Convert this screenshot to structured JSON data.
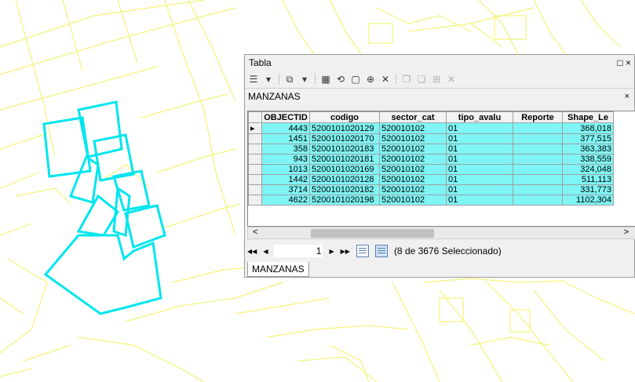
{
  "window": {
    "title": "Tabla",
    "maximize_glyph": "□",
    "close_glyph": "×"
  },
  "toolbar": {
    "icons": [
      "table-options-icon",
      "related-tables-icon",
      "select-by-attributes-icon",
      "switch-selection-icon",
      "clear-selection-icon",
      "zoom-to-selected-icon",
      "delete-selected-icon",
      "copy-icon",
      "paste-icon",
      "add-icon",
      "remove-icon"
    ],
    "dropdown_glyph": "▾"
  },
  "table_tab": {
    "name": "MANZANAS",
    "close_glyph": "×"
  },
  "grid": {
    "columns": [
      "OBJECTID",
      "codigo",
      "sector_cat",
      "tipo_avalu",
      "Reporte",
      "Shape_Le"
    ],
    "rows": [
      {
        "objectid": "4443",
        "codigo": "5200101020129",
        "sector_cat": "520010102",
        "tipo_avalu": "01",
        "reporte": "",
        "shape_le": "368,018"
      },
      {
        "objectid": "1451",
        "codigo": "5200101020170",
        "sector_cat": "520010102",
        "tipo_avalu": "01",
        "reporte": "",
        "shape_le": "377,515"
      },
      {
        "objectid": "358",
        "codigo": "5200101020183",
        "sector_cat": "520010102",
        "tipo_avalu": "01",
        "reporte": "",
        "shape_le": "363,383"
      },
      {
        "objectid": "943",
        "codigo": "5200101020181",
        "sector_cat": "520010102",
        "tipo_avalu": "01",
        "reporte": "",
        "shape_le": "338,559"
      },
      {
        "objectid": "1013",
        "codigo": "5200101020169",
        "sector_cat": "520010102",
        "tipo_avalu": "01",
        "reporte": "",
        "shape_le": "324,048"
      },
      {
        "objectid": "1442",
        "codigo": "5200101020128",
        "sector_cat": "520010102",
        "tipo_avalu": "01",
        "reporte": "",
        "shape_le": "511,113"
      },
      {
        "objectid": "3714",
        "codigo": "5200101020182",
        "sector_cat": "520010102",
        "tipo_avalu": "01",
        "reporte": "",
        "shape_le": "331,773"
      },
      {
        "objectid": "4622",
        "codigo": "5200101020198",
        "sector_cat": "520010102",
        "tipo_avalu": "01",
        "reporte": "",
        "shape_le": "1102,304"
      }
    ],
    "current_row_marker": "▸",
    "selection_color": "#7ff5f5"
  },
  "scrollbar": {
    "left_arrow": "<",
    "right_arrow": ">"
  },
  "navigation": {
    "first_glyph": "◀◀",
    "prev_glyph": "◀",
    "current_record": "1",
    "next_glyph": "▶",
    "last_glyph": "▶▶",
    "status": "(8 de 3676 Seleccionado)"
  },
  "bottom_tab": {
    "label": "MANZANAS"
  },
  "map": {
    "street_color": "#f4f27a",
    "selection_outline_color": "#00e5ee"
  }
}
